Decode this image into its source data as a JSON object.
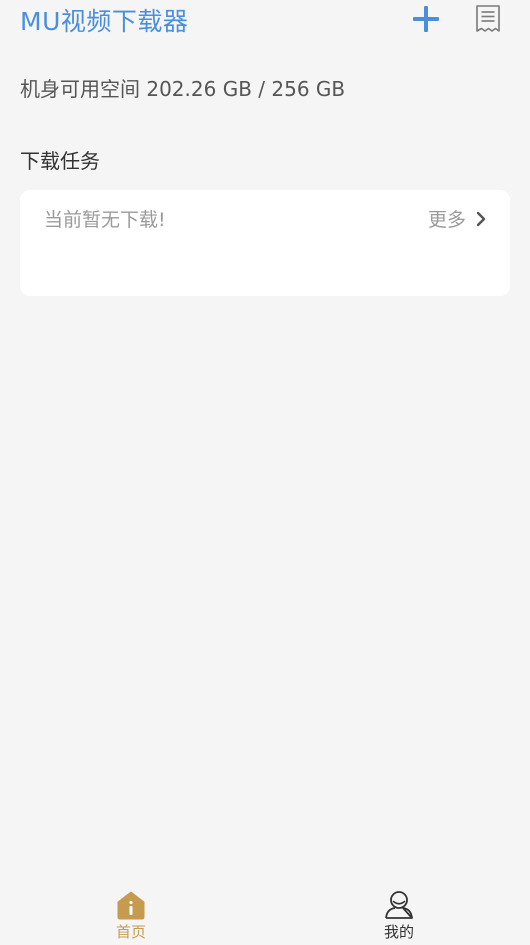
{
  "header": {
    "title": "MU视频下载器",
    "add_icon": "plus-icon",
    "doc_icon": "document-list-icon"
  },
  "storage": {
    "text": "机身可用空间 202.26 GB / 256 GB"
  },
  "downloads": {
    "section_title": "下载任务",
    "empty_message": "当前暂无下载!",
    "more_label": "更多",
    "more_icon": "chevron-right-icon"
  },
  "bottom_nav": {
    "items": [
      {
        "label": "首页",
        "icon": "home-icon",
        "active": true
      },
      {
        "label": "我的",
        "icon": "user-icon",
        "active": false
      }
    ]
  },
  "colors": {
    "accent": "#4a8fde",
    "active_nav": "#c69b4f",
    "background": "#f5f5f5",
    "card": "#ffffff"
  }
}
